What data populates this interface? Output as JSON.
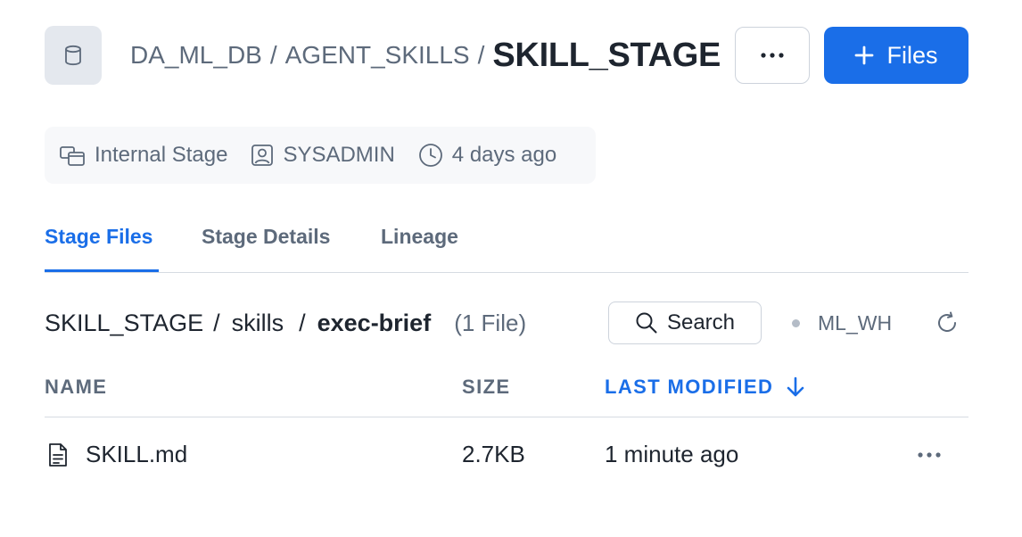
{
  "header": {
    "icon": "database-icon",
    "breadcrumb": [
      "DA_ML_DB",
      "AGENT_SKILLS"
    ],
    "separator": "/",
    "current": "SKILL_STAGE",
    "more_icon": "more-horizontal-icon",
    "files_button_label": "Files",
    "files_button_icon": "plus-icon"
  },
  "meta": {
    "stage_type": "Internal Stage",
    "owner": "SYSADMIN",
    "modified": "4 days ago"
  },
  "tabs": [
    {
      "label": "Stage Files",
      "active": true
    },
    {
      "label": "Stage Details",
      "active": false
    },
    {
      "label": "Lineage",
      "active": false
    }
  ],
  "path": {
    "parts": [
      "SKILL_STAGE",
      "skills"
    ],
    "separator": "/",
    "current": "exec-brief",
    "file_count": "(1 File)"
  },
  "toolbar": {
    "search_label": "Search",
    "warehouse": "ML_WH"
  },
  "table": {
    "columns": [
      "NAME",
      "SIZE",
      "LAST MODIFIED"
    ],
    "sorted_column": "LAST MODIFIED",
    "rows": [
      {
        "name": "SKILL.md",
        "size": "2.7KB",
        "last_modified": "1 minute ago"
      }
    ]
  },
  "colors": {
    "accent": "#1a6ee8",
    "text_primary": "#1e252f",
    "text_secondary": "#5d6a7b",
    "border": "#cdd3dc"
  }
}
